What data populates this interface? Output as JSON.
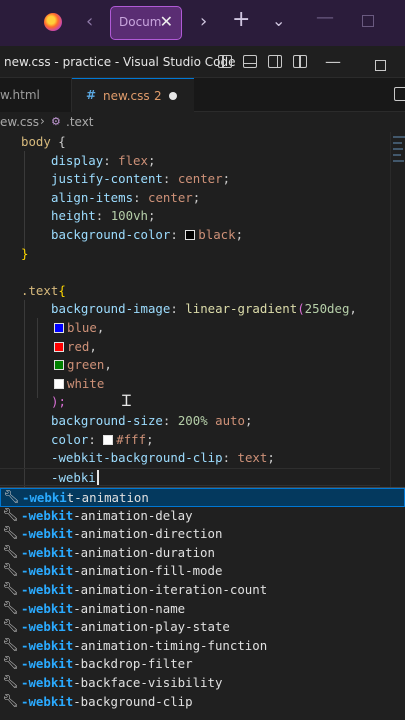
{
  "browser": {
    "tab_title": "Docum",
    "tab_close": "✕",
    "back": "‹",
    "forward": "›",
    "new_tab": "+",
    "tab_list": "⌄",
    "minimize": "—",
    "icons": [
      "firefox-icon",
      "back-icon",
      "forward-icon",
      "new-tab-icon",
      "tab-list-icon"
    ]
  },
  "window": {
    "title": "new.css - practice - Visual Studio Code",
    "minimize": "—"
  },
  "tabs": [
    {
      "label": "w.html",
      "active": false
    },
    {
      "label": "new.css",
      "badge": "2",
      "active": true,
      "modified": true
    }
  ],
  "breadcrumb": {
    "file": "ew.css",
    "separator": "›",
    "symbol": ".text"
  },
  "code": {
    "body_selector": "body",
    "open_brace": " {",
    "close_brace": "}",
    "body_decls": [
      {
        "prop": "display",
        "value": "flex"
      },
      {
        "prop": "justify-content",
        "value": "center"
      },
      {
        "prop": "align-items",
        "value": "center"
      },
      {
        "prop": "height",
        "value": "100vh"
      },
      {
        "prop": "background-color",
        "value": "black",
        "swatch": "#000000"
      }
    ],
    "text_selector": ".text",
    "text_open": "{",
    "bg_image_prop": "background-image",
    "gradient_fn": "linear-gradient",
    "gradient_angle": "250deg",
    "gradient_colors": [
      {
        "name": "blue",
        "swatch": "#0000ff",
        "sep": ","
      },
      {
        "name": "red",
        "swatch": "#ff0000",
        "sep": ","
      },
      {
        "name": "green",
        "swatch": "#008000",
        "sep": ","
      },
      {
        "name": "white",
        "swatch": "#ffffff",
        "sep": ""
      }
    ],
    "gradient_close": ");",
    "bg_size_prop": "background-size",
    "bg_size_value": "200%",
    "bg_size_auto": "auto",
    "color_prop": "color",
    "color_value": "#fff",
    "color_swatch": "#ffffff",
    "clip_prop": "-webkit-background-clip",
    "clip_value": "text",
    "typed": "-webki"
  },
  "suggestions": {
    "match": "-webkit",
    "items": [
      {
        "match": "-webki",
        "rest": "t-animation",
        "focused": true
      },
      {
        "match": "-webkit",
        "rest": "-animation-delay"
      },
      {
        "match": "-webkit",
        "rest": "-animation-direction"
      },
      {
        "match": "-webkit",
        "rest": "-animation-duration"
      },
      {
        "match": "-webkit",
        "rest": "-animation-fill-mode"
      },
      {
        "match": "-webkit",
        "rest": "-animation-iteration-count"
      },
      {
        "match": "-webkit",
        "rest": "-animation-name"
      },
      {
        "match": "-webkit",
        "rest": "-animation-play-state"
      },
      {
        "match": "-webkit",
        "rest": "-animation-timing-function"
      },
      {
        "match": "-webkit",
        "rest": "-backdrop-filter"
      },
      {
        "match": "-webkit",
        "rest": "-backface-visibility"
      },
      {
        "match": "-webkit",
        "rest": "-background-clip"
      }
    ]
  },
  "colors": {
    "accent": "#0078d4",
    "match_highlight": "#2aaaff",
    "modified_tab": "#e09c6b"
  }
}
